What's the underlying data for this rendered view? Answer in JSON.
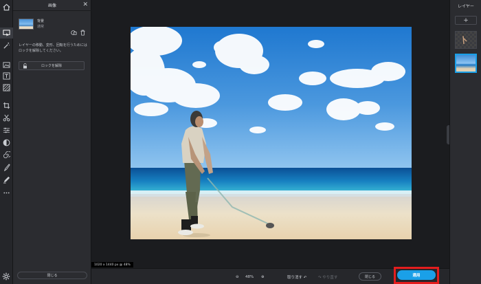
{
  "left_panel": {
    "title": "画像",
    "close_icon": "✕",
    "layer_name": "背景",
    "layer_mode": "通常",
    "description": "レイヤーの移動、変形、回転を行うためにはロックを解除してください。",
    "unlock_label": "ロックを解除",
    "close_label": "閉じる"
  },
  "canvas": {
    "size_label": "1020 x 1440 px @ 48%"
  },
  "bottom_bar": {
    "zoom_out": "⊖",
    "zoom_value": "48%",
    "zoom_in": "⊕",
    "undo_label": "取り消す ↶",
    "redo_label": "↷ やり直す",
    "cancel_label": "閉じる",
    "apply_label": "適用"
  },
  "right_panel": {
    "title": "レイヤー",
    "add_label": "+"
  },
  "colors": {
    "accent": "#1aa0e8",
    "highlight": "#e41d1d",
    "panel_bg": "#2b2c30",
    "canvas_bg": "#1b1c1f"
  }
}
